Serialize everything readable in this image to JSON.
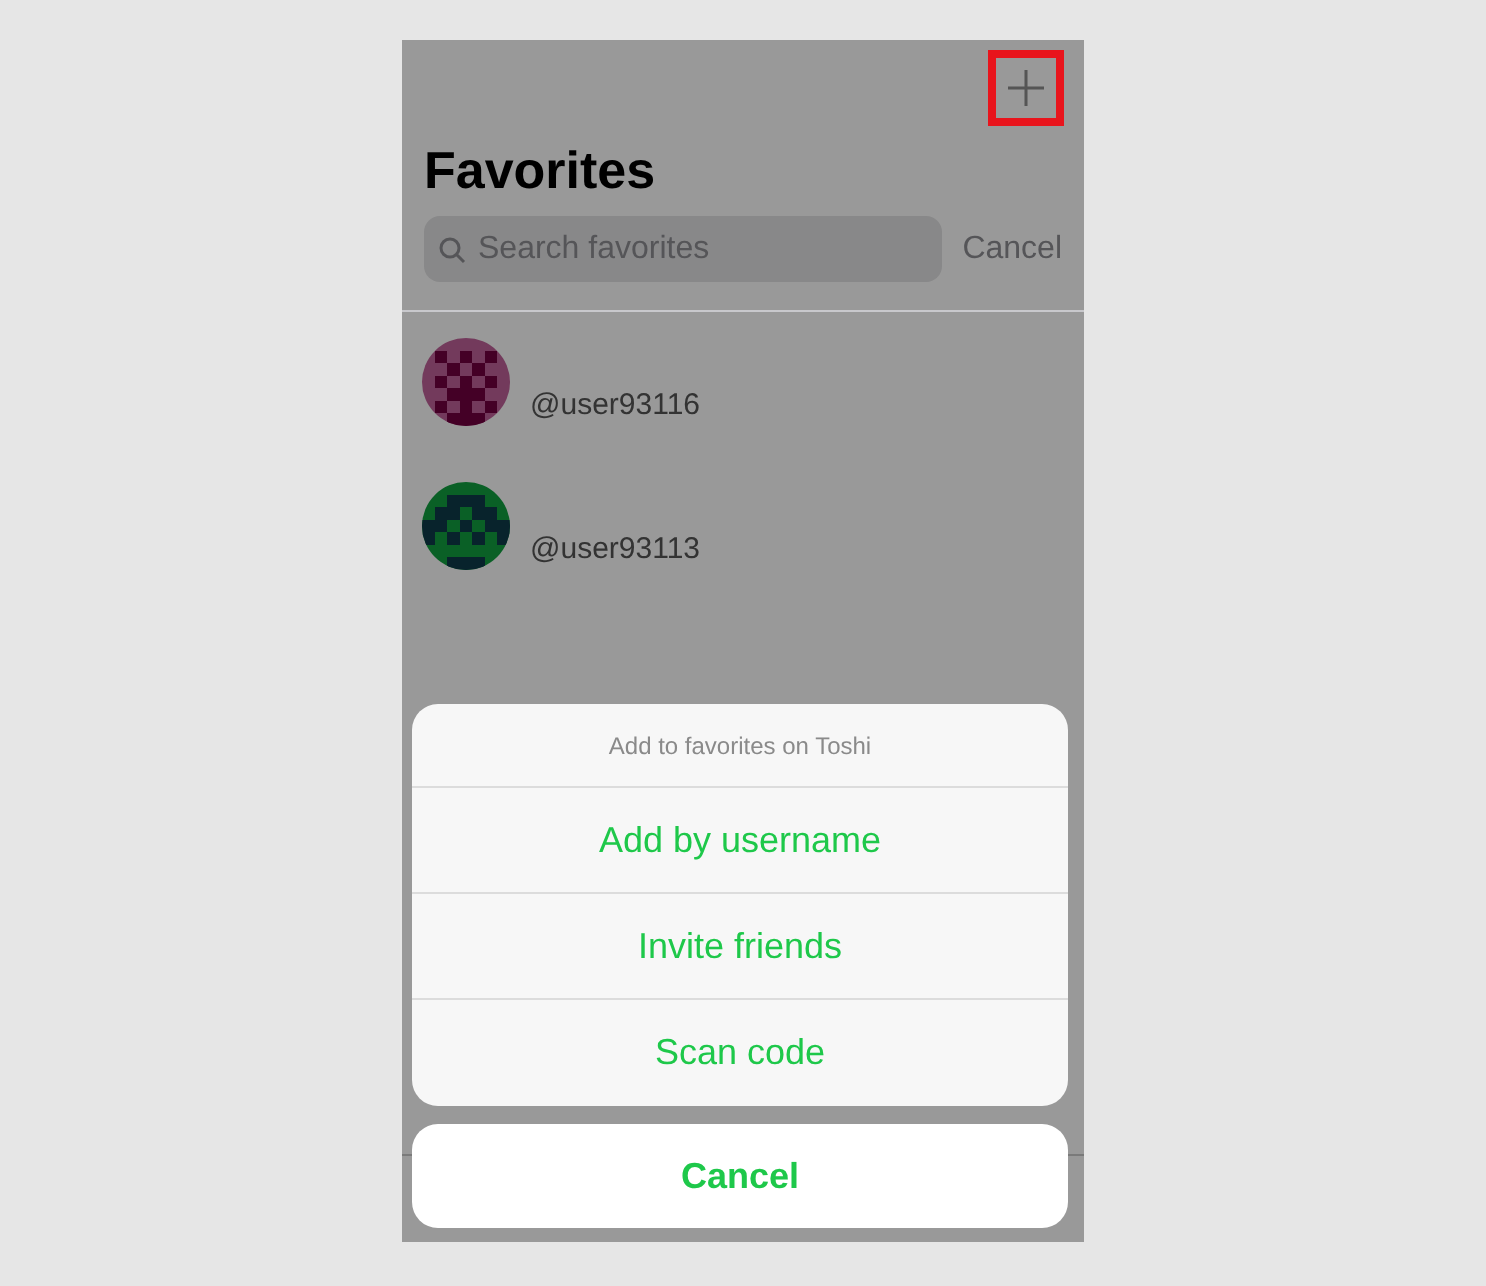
{
  "header": {
    "add_icon_highlighted": true,
    "title": "Favorites"
  },
  "search": {
    "placeholder": "Search favorites",
    "cancel": "Cancel"
  },
  "favorites": [
    {
      "username": "@user93116",
      "color": "#733a5c"
    },
    {
      "username": "@user93113",
      "color": "#0a6026"
    }
  ],
  "action_sheet": {
    "title": "Add to favorites on Toshi",
    "actions": [
      "Add by username",
      "Invite friends",
      "Scan code"
    ],
    "cancel": "Cancel"
  }
}
